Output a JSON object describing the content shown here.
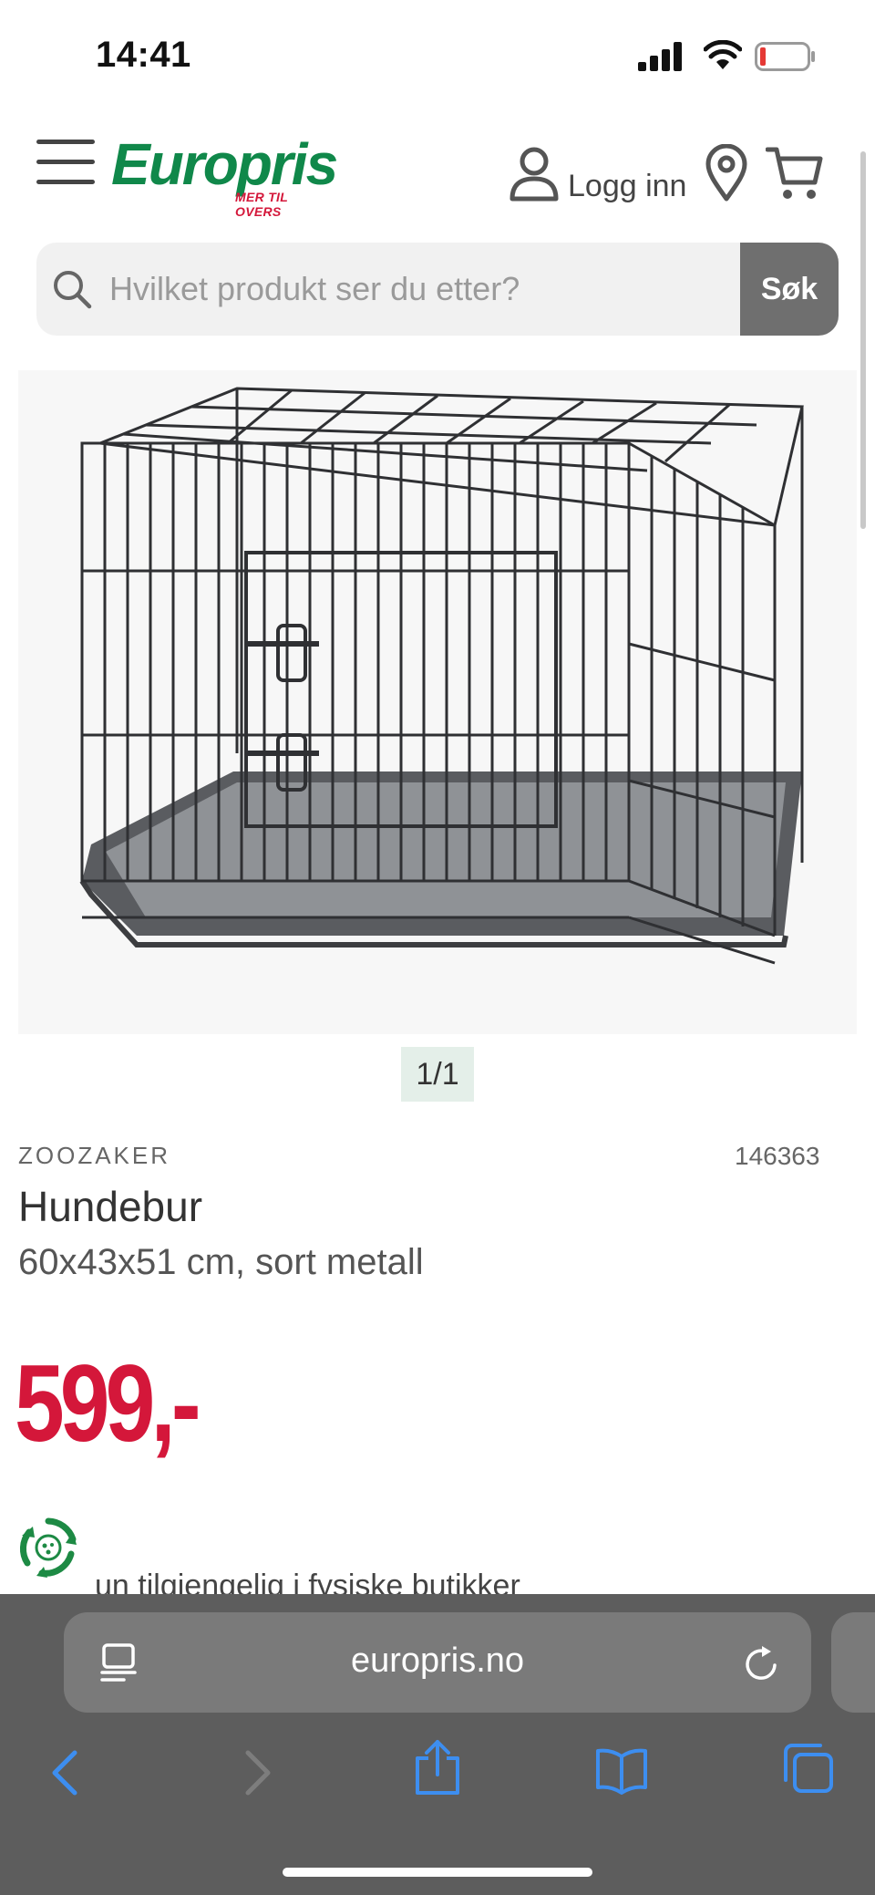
{
  "status_bar": {
    "time": "14:41"
  },
  "header": {
    "logo_text": "Europris",
    "logo_tagline": "MER TIL OVERS",
    "login_label": "Logg inn"
  },
  "search": {
    "placeholder": "Hvilket produkt ser du etter?",
    "button_label": "Søk"
  },
  "product": {
    "image_counter": "1/1",
    "brand": "ZOOZAKER",
    "sku": "146363",
    "title": "Hundebur",
    "subtitle": "60x43x51 cm, sort metall",
    "price": "599,-",
    "availability": "un tilgjengelig i fysiske butikker"
  },
  "browser": {
    "url": "europris.no"
  },
  "colors": {
    "brand_green": "#10884a",
    "price_red": "#d4173a",
    "browser_blue": "#3d8ef0",
    "browser_chrome": "#5d5d5d"
  }
}
